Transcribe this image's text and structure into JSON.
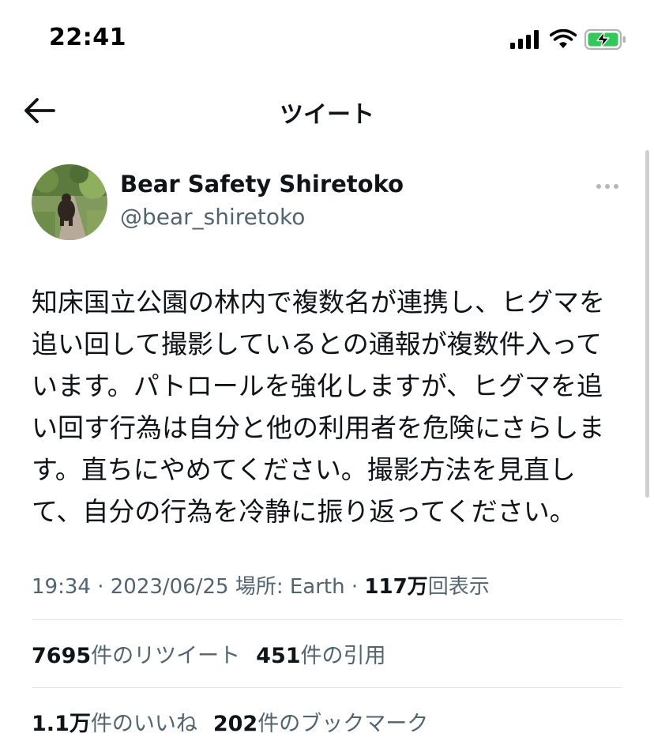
{
  "status_bar": {
    "time": "22:41",
    "icons": [
      "cellular-signal-icon",
      "wifi-icon",
      "battery-charging-icon"
    ],
    "battery_color": "#34c759"
  },
  "nav": {
    "back_icon": "back-arrow-icon",
    "title": "ツイート"
  },
  "tweet": {
    "author": {
      "display_name": "Bear Safety Shiretoko",
      "handle": "@bear_shiretoko",
      "avatar": "avatar-bear-photo"
    },
    "more_icon": "more-options-icon",
    "text_lines": [
      "知床国立公園の林内で複数名が連携し、ヒグマを",
      "追い回して撮影しているとの通報が複数件入って",
      "います。パトロールを強化しますが、ヒグマを追",
      "い回す行為は自分と他の利用者を危険にさらしま",
      "す。直ちにやめてください。撮影方法を見直し",
      "て、自分の行為を冷静に振り返ってください。"
    ],
    "meta": {
      "time": "19:34",
      "separator": "·",
      "date": "2023/06/25",
      "location": "場所: Earth",
      "views_count": "117万",
      "views_label": "回表示"
    }
  },
  "stats": {
    "retweets": {
      "count": "7695",
      "label": "件のリツイート"
    },
    "quotes": {
      "count": "451",
      "label": "件の引用"
    },
    "likes": {
      "count": "1.1万",
      "label": "件のいいね"
    },
    "bookmarks": {
      "count": "202",
      "label": "件のブックマーク"
    }
  },
  "colors": {
    "text_primary": "#0f1419",
    "text_secondary": "#536471",
    "divider": "#e4e6ea"
  }
}
